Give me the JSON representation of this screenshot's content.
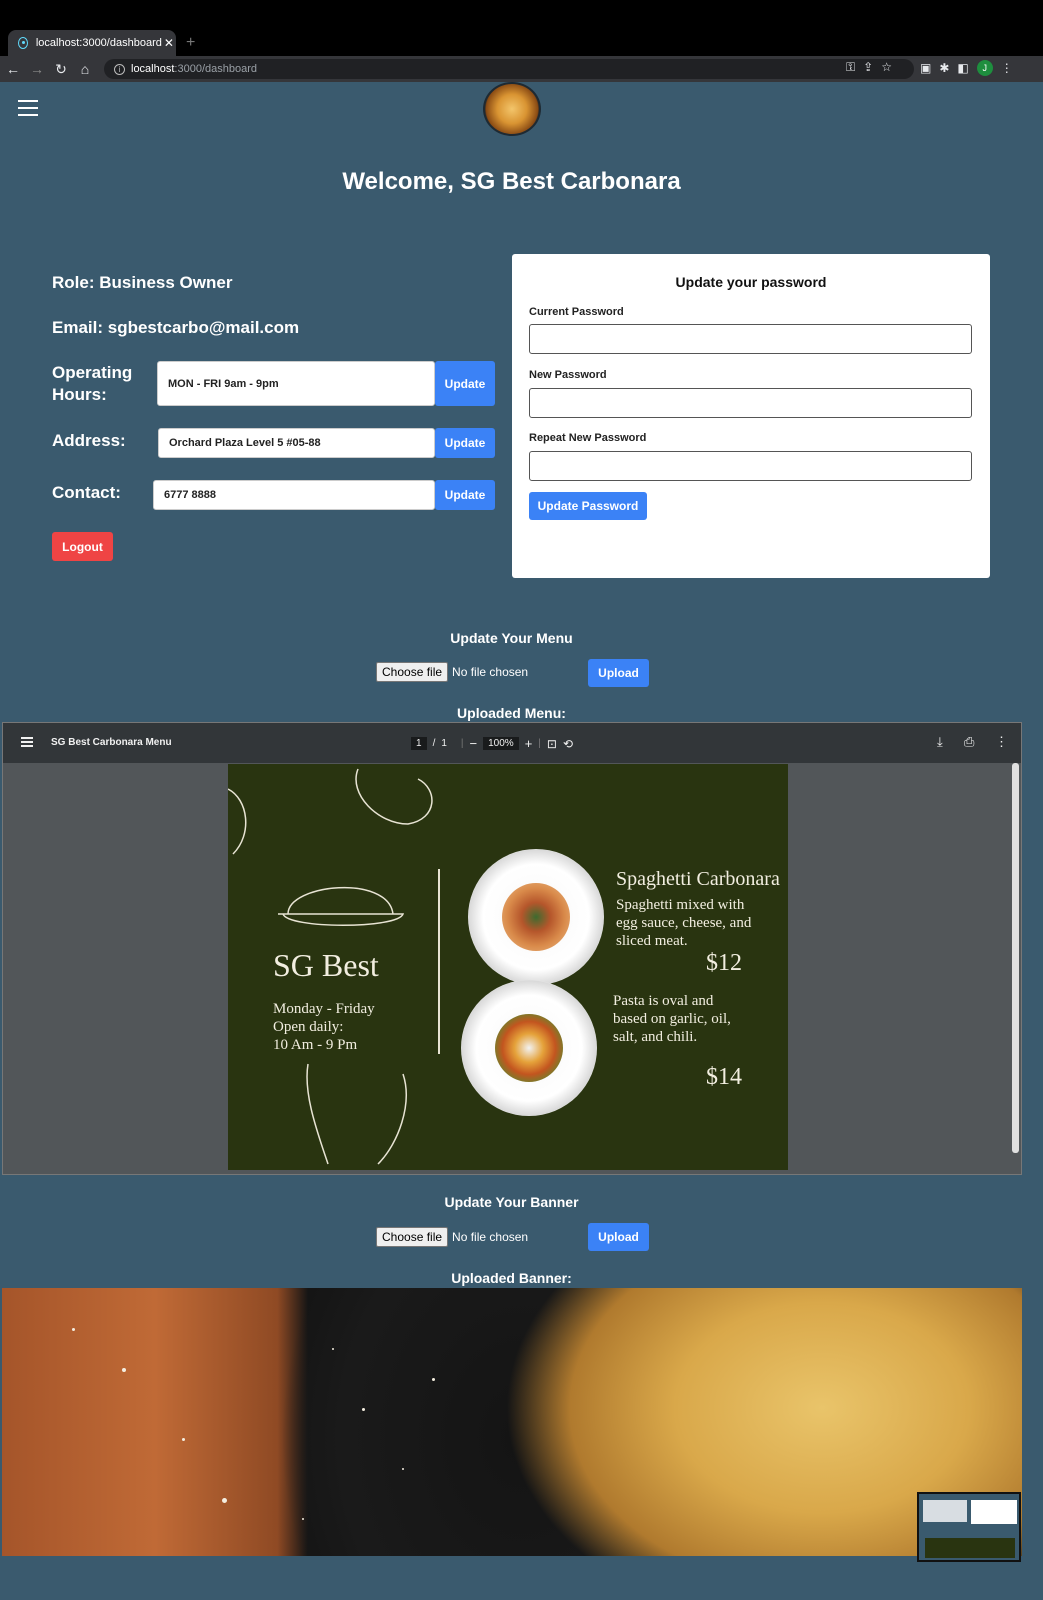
{
  "browser": {
    "tab_title": "localhost:3000/dashboard",
    "url_host": "localhost",
    "url_path": ":3000/dashboard",
    "profile_initial": "J"
  },
  "header": {
    "welcome": "Welcome, SG Best Carbonara"
  },
  "profile": {
    "role": "Role: Business Owner",
    "email": "Email: sgbestcarbo@mail.com",
    "operating_hours_label": "Operating Hours:",
    "operating_hours_value": "MON - FRI 9am - 9pm",
    "address_label": "Address:",
    "address_value": "Orchard Plaza Level 5 #05-88",
    "contact_label": "Contact:",
    "contact_value": "6777 8888",
    "update_label": "Update",
    "logout_label": "Logout"
  },
  "password": {
    "title": "Update your password",
    "current_label": "Current Password",
    "new_label": "New Password",
    "repeat_label": "Repeat New Password",
    "button_label": "Update Password"
  },
  "menu_upload": {
    "title": "Update Your Menu",
    "choose_label": "Choose file",
    "no_file": "No file chosen",
    "upload_label": "Upload",
    "uploaded_title": "Uploaded Menu:"
  },
  "pdf": {
    "doc_title": "SG Best Carbonara Menu",
    "page_current": "1",
    "page_total": "1",
    "zoom": "100%"
  },
  "menu_page": {
    "brand": "SG Best",
    "hours_line1": "Monday - Friday",
    "hours_line2": "Open daily:",
    "hours_line3": "10 Am - 9 Pm",
    "dish1_name": "Spaghetti Carbonara",
    "dish1_desc1": "Spaghetti mixed with",
    "dish1_desc2": "egg sauce, cheese, and",
    "dish1_desc3": "sliced meat.",
    "dish1_price": "$12",
    "dish2_desc1": "Pasta is oval and",
    "dish2_desc2": "based on garlic, oil,",
    "dish2_desc3": "salt, and chili.",
    "dish2_price": "$14"
  },
  "banner_upload": {
    "title": "Update Your Banner",
    "choose_label": "Choose file",
    "no_file": "No file chosen",
    "upload_label": "Upload",
    "uploaded_title": "Uploaded Banner:"
  },
  "colors": {
    "page_bg": "#3a5a6e",
    "accent": "#3b82f6",
    "danger": "#ef4444",
    "menu_bg": "#293410"
  }
}
